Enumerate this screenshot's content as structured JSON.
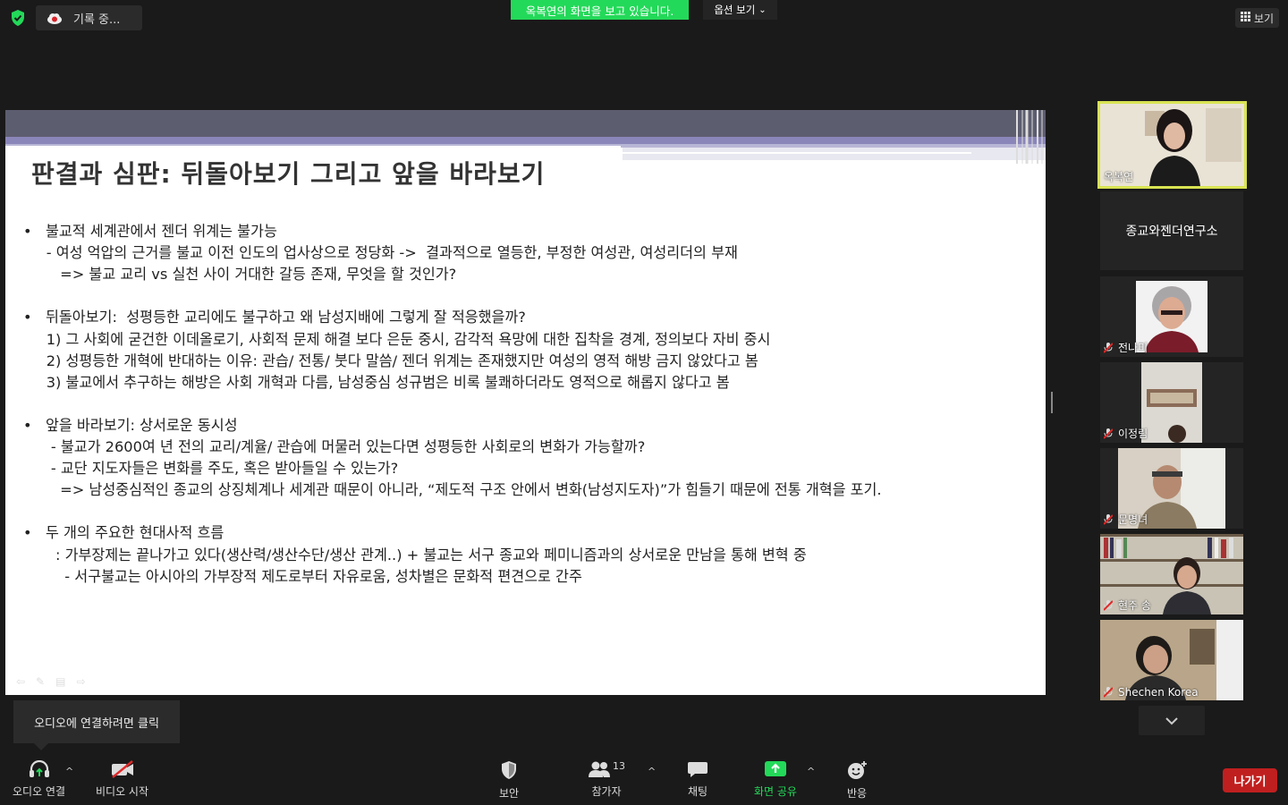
{
  "top": {
    "recording_label": "기록 중...",
    "share_banner": "옥복연의 화면을 보고 있습니다.",
    "view_options": "옵션 보기",
    "view_button": "보기"
  },
  "slide": {
    "title": "판결과 심판: 뒤돌아보기 그리고 앞을 바라보기",
    "lines": [
      "•   불교적 세계관에서 젠더 위계는 불가능",
      "     - 여성 억압의 근거를 불교 이전 인도의 업사상으로 정당화 ->  결과적으로 열등한, 부정한 여성관, 여성리더의 부재",
      "        => 불교 교리 vs 실천 사이 거대한 갈등 존재, 무엇을 할 것인가?",
      "",
      "•   뒤돌아보기:  성평등한 교리에도 불구하고 왜 남성지배에 그렇게 잘 적응했을까?",
      "     1) 그 사회에 굳건한 이데올로기, 사회적 문제 해결 보다 은둔 중시, 감각적 욕망에 대한 집착을 경계, 정의보다 자비 중시",
      "     2) 성평등한 개혁에 반대하는 이유: 관습/ 전통/ 붓다 말씀/ 젠더 위계는 존재했지만 여성의 영적 해방 금지 않았다고 봄",
      "     3) 불교에서 추구하는 해방은 사회 개혁과 다름, 남성중심 성규범은 비록 불쾌하더라도 영적으로 해롭지 않다고 봄",
      "",
      "•   앞을 바라보기: 상서로운 동시성",
      "      - 불교가 2600여 년 전의 교리/계율/ 관습에 머물러 있는다면 성평등한 사회로의 변화가 가능할까?",
      "      - 교단 지도자들은 변화를 주도, 혹은 받아들일 수 있는가?",
      "        => 남성중심적인 종교의 상징체계나 세계관 때문이 아니라, “제도적 구조 안에서 변화(남성지도자)”가 힘들기 때문에 전통 개혁을 포기.",
      "",
      "•   두 개의 주요한 현대사적 흐름",
      "       : 가부장제는 끝나가고 있다(생산력/생산수단/생산 관계..) + 불교는 서구 종교와 페미니즘과의 상서로운 만남을 통해 변혁 중",
      "         - 서구불교는 아시아의 가부장적 제도로부터 자유로움, 성차별은 문화적 편견으로 간주"
    ]
  },
  "tooltip": "오디오에 연결하려면 클릭",
  "participants": {
    "active_name": "옥복연",
    "org_name": "종교와젠더연구소",
    "p1": "전나미",
    "p2": "이정림",
    "p3": "문명녀",
    "p4": "현주 송",
    "p5": "Shechen Korea"
  },
  "toolbar": {
    "audio": "오디오 연결",
    "video": "비디오 시작",
    "security": "보안",
    "participants": "참가자",
    "participant_count": "13",
    "chat": "채팅",
    "share": "화면 공유",
    "reactions": "반응",
    "leave": "나가기"
  }
}
